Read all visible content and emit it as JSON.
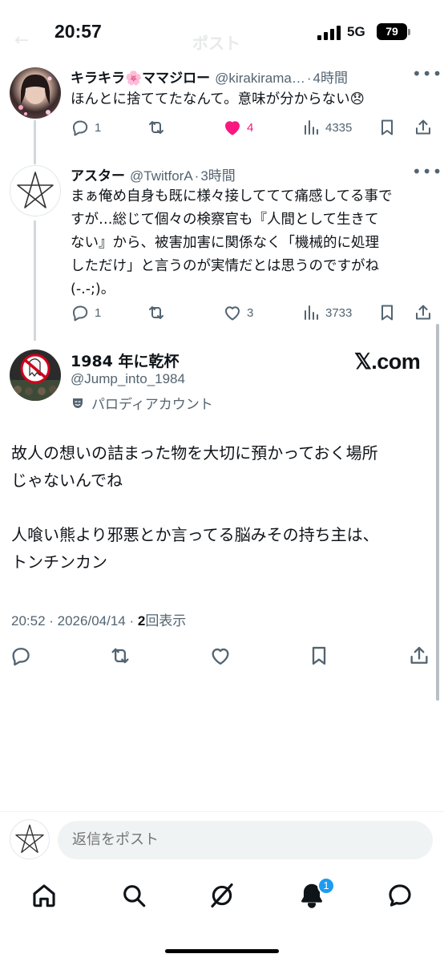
{
  "status_bar": {
    "time": "20:57",
    "network": "5G",
    "battery": "79"
  },
  "header": {
    "back_label": "←",
    "title": "ポスト"
  },
  "tweets": [
    {
      "name": "キラキラ🌸ママジロー",
      "handle": "@kirakirama…",
      "time": "4時間",
      "more": "•••",
      "text": "ほんとに捨ててたなんて。意味が分からない😞",
      "replies": "1",
      "retweets": "",
      "likes": "4",
      "views": "4335",
      "liked": true
    },
    {
      "name": "アスター",
      "handle": "@TwitforA",
      "time": "3時間",
      "more": "•••",
      "lines": [
        "まぁ俺め自身も既に様々接しててて痛感してる事で",
        "すが…総じて個々の検察官も『人間として生きて",
        "ない』から、被害加害に関係なく「機械的に処理",
        "しただけ」と言うのが実情だとは思うのですがね",
        "(-.-;)。"
      ],
      "replies": "1",
      "retweets": "",
      "likes": "3",
      "views": "3733",
      "liked": false
    }
  ],
  "main_tweet": {
    "name": "1984 年に乾杯",
    "handle": "@Jump_into_1984",
    "parody_label": "パロディアカウント",
    "source": "𝕏.com",
    "paragraphs": [
      [
        "故人の想いの詰まった物を大切に預かっておく場所",
        "じゃないんでね"
      ],
      [
        "人喰い熊より邪悪とか言ってる脳みその持ち主は、",
        "トンチンカン"
      ]
    ],
    "timestamp": "20:52 · 2026/04/14 · ",
    "views_count": "2",
    "views_label": "回表示"
  },
  "reply_bar": {
    "placeholder": "返信をポスト"
  },
  "bottom_nav": {
    "notification_badge": "1",
    "items": [
      "home-icon",
      "search-icon",
      "grok-icon",
      "notifications-icon",
      "messages-icon"
    ]
  },
  "colors": {
    "like": "#f91880",
    "accent": "#1d9bf0",
    "muted": "#536471"
  }
}
